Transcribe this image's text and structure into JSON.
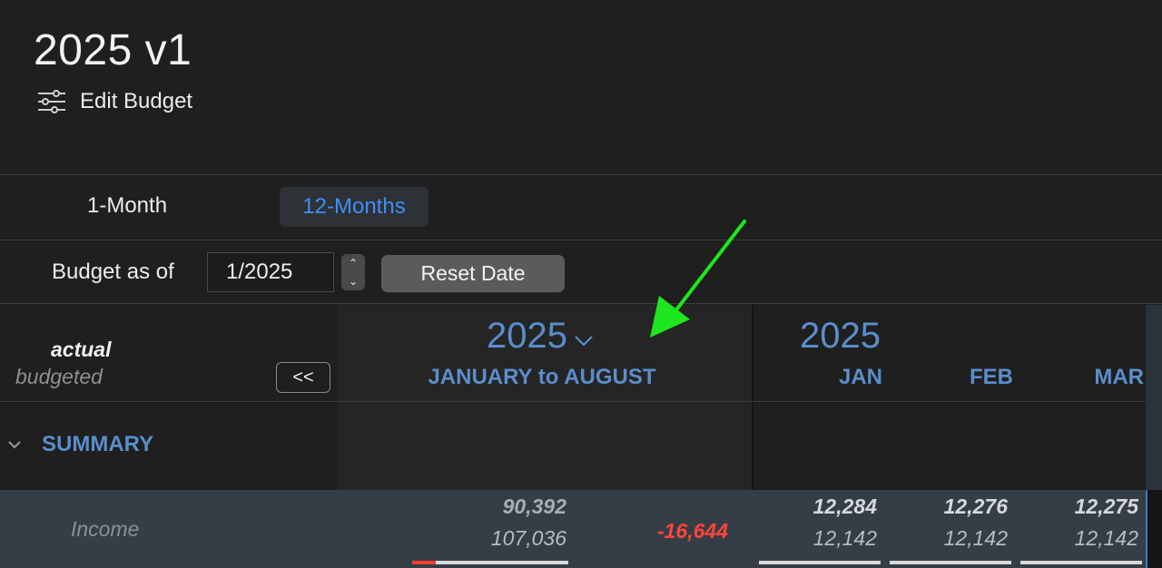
{
  "header": {
    "title": "2025 v1",
    "edit_label": "Edit Budget",
    "edit_icon": "sliders-icon"
  },
  "period_toggle": {
    "one_month": "1-Month",
    "twelve_months": "12-Months",
    "selected": "12-Months"
  },
  "date_controls": {
    "label": "Budget as of",
    "value": "1/2025",
    "reset_label": "Reset Date"
  },
  "grid": {
    "left_header": {
      "actual": "actual",
      "budgeted": "budgeted",
      "back_button": "<<"
    },
    "summary_column": {
      "year": "2025",
      "range": "JANUARY to AUGUST"
    },
    "months_column": {
      "year": "2025",
      "months": [
        "JAN",
        "FEB",
        "MAR"
      ]
    },
    "section": "SUMMARY",
    "income": {
      "label": "Income",
      "range_actual": "90,392",
      "range_budgeted": "107,036",
      "range_variance": "-16,644",
      "range_progress": 0.15,
      "monthly": [
        {
          "actual": "12,284",
          "budgeted": "12,142"
        },
        {
          "actual": "12,276",
          "budgeted": "12,142"
        },
        {
          "actual": "12,275",
          "budgeted": "12,142"
        }
      ]
    }
  },
  "colors": {
    "accent_blue": "#5a8ecb",
    "selected_blue": "#3f8ef7",
    "negative_red": "#ff453a",
    "annotation_green": "#1ee61e"
  }
}
